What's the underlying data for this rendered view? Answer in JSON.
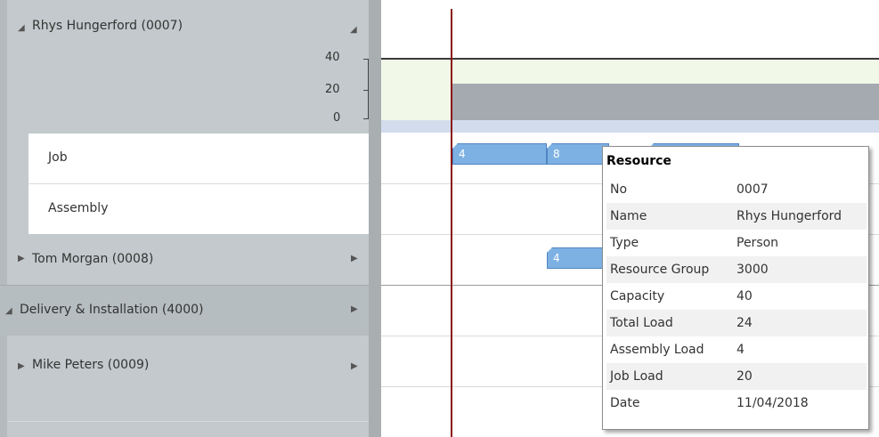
{
  "resources": {
    "rhys": {
      "label": "Rhys Hungerford (0007)"
    },
    "job_label": "Job",
    "assembly_label": "Assembly",
    "tom": {
      "label": "Tom Morgan (0008)"
    },
    "delivery": {
      "label": "Delivery & Installation (4000)"
    },
    "mike": {
      "label": "Mike Peters (0009)"
    }
  },
  "axis": {
    "ticks": [
      "40",
      "20",
      "0"
    ]
  },
  "tasks": {
    "job_1": "4",
    "job_2": "8",
    "tom_1": "4"
  },
  "tooltip": {
    "title": "Resource",
    "rows": [
      {
        "key": "No",
        "value": "0007"
      },
      {
        "key": "Name",
        "value": "Rhys Hungerford"
      },
      {
        "key": "Type",
        "value": "Person"
      },
      {
        "key": "Resource Group",
        "value": "3000"
      },
      {
        "key": "Capacity",
        "value": "40"
      },
      {
        "key": "Total Load",
        "value": "24"
      },
      {
        "key": "Assembly Load",
        "value": "4"
      },
      {
        "key": "Job Load",
        "value": "20"
      },
      {
        "key": "Date",
        "value": "11/04/2018"
      }
    ]
  },
  "colors": {
    "panel": "#c3c9cc",
    "task": "#7eb1e3",
    "today_line": "#8a1414",
    "capacity_band": "#f1f8e8",
    "load_bar": "#a5a9b0"
  }
}
